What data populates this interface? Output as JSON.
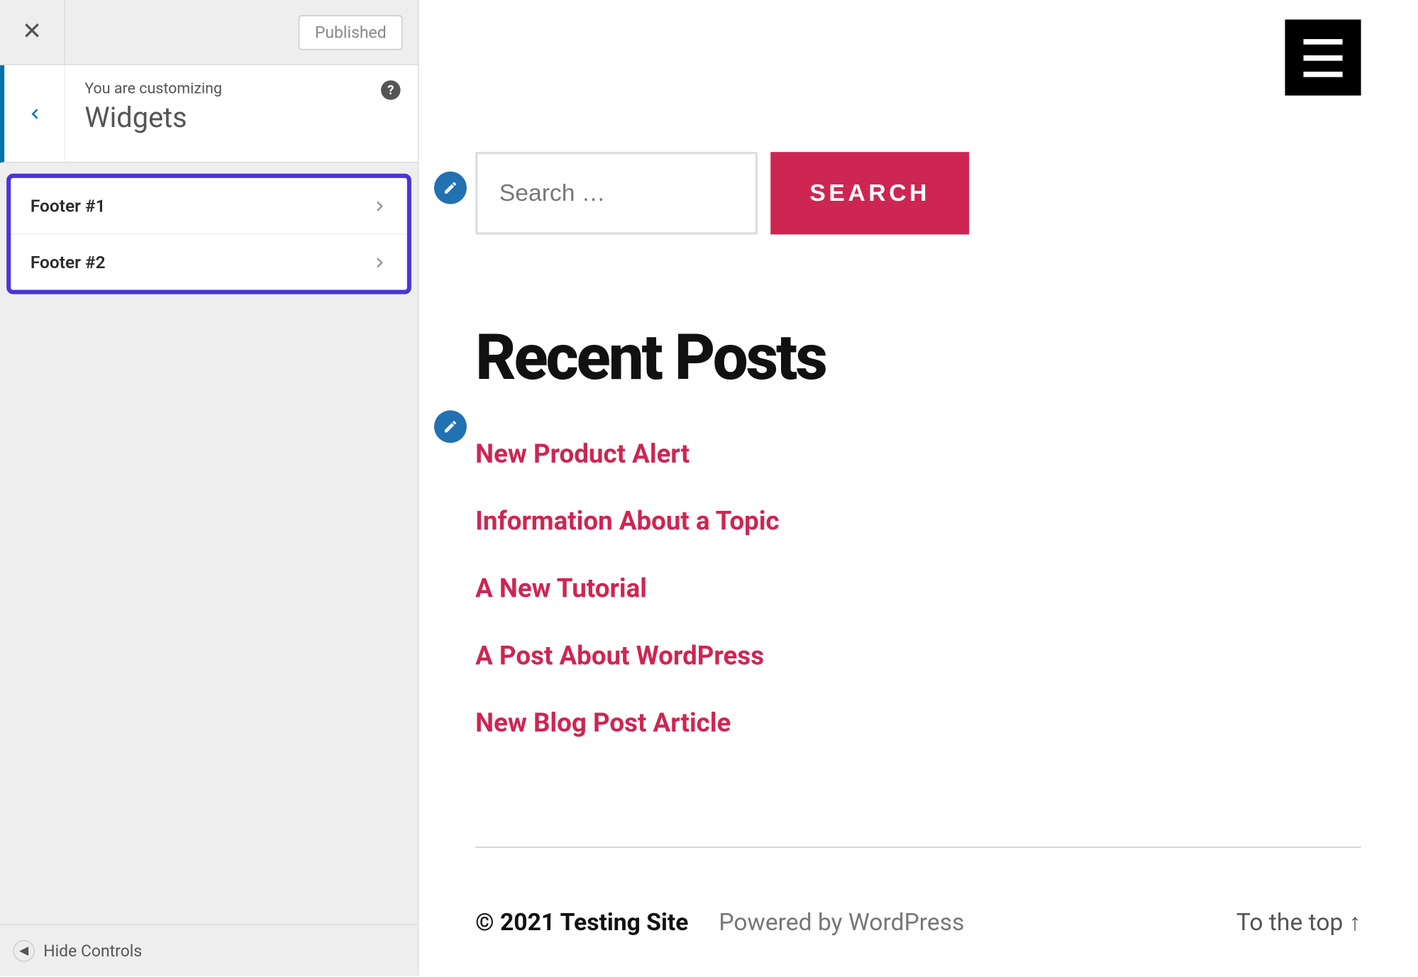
{
  "sidebar": {
    "publish_status": "Published",
    "customizing_label": "You are customizing",
    "section_title": "Widgets",
    "items": [
      {
        "label": "Footer #1"
      },
      {
        "label": "Footer #2"
      }
    ],
    "hide_controls_label": "Hide Controls"
  },
  "search": {
    "placeholder": "Search …",
    "button_label": "SEARCH"
  },
  "recent_posts": {
    "heading": "Recent Posts",
    "items": [
      "New Product Alert",
      "Information About a Topic",
      "A New Tutorial",
      "A Post About WordPress",
      "New Blog Post Article"
    ]
  },
  "footer": {
    "copyright": "© 2021 Testing Site",
    "powered": "Powered by WordPress",
    "to_top": "To the top ↑"
  },
  "icons": {
    "close": "✕",
    "back": "‹",
    "chevron_right": "›",
    "help": "?",
    "triangle_left": "◀"
  }
}
